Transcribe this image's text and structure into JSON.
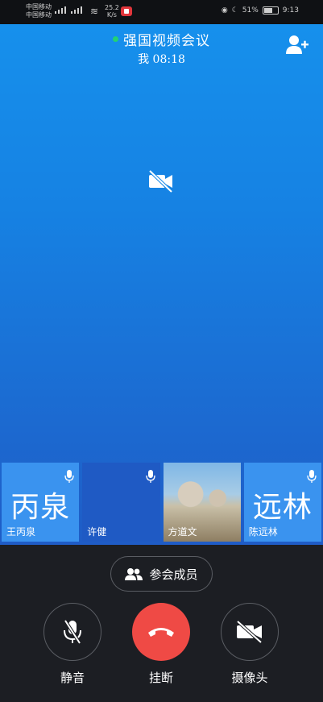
{
  "status_bar": {
    "carrier_line1": "中国移动",
    "carrier_line2": "中国移动",
    "net_speed_value": "25.2",
    "net_speed_unit": "K/s",
    "battery": "51%",
    "time": "9:13"
  },
  "meeting": {
    "title": "强国视频会议",
    "subtitle": "我 08:18",
    "status_color": "#22d273"
  },
  "participants": [
    {
      "display": "丙泉",
      "name": "王丙泉",
      "avatar_type": "text"
    },
    {
      "display": "",
      "name": "许健",
      "avatar_type": "none"
    },
    {
      "display": "",
      "name": "方道文",
      "avatar_type": "photo"
    },
    {
      "display": "远林",
      "name": "陈远林",
      "avatar_type": "text"
    }
  ],
  "controls": {
    "members_label": "参会成员",
    "mute_label": "静音",
    "hangup_label": "挂断",
    "camera_label": "摄像头"
  },
  "colors": {
    "hangup": "#ef4a45",
    "accent_blue": "#1690ec"
  }
}
